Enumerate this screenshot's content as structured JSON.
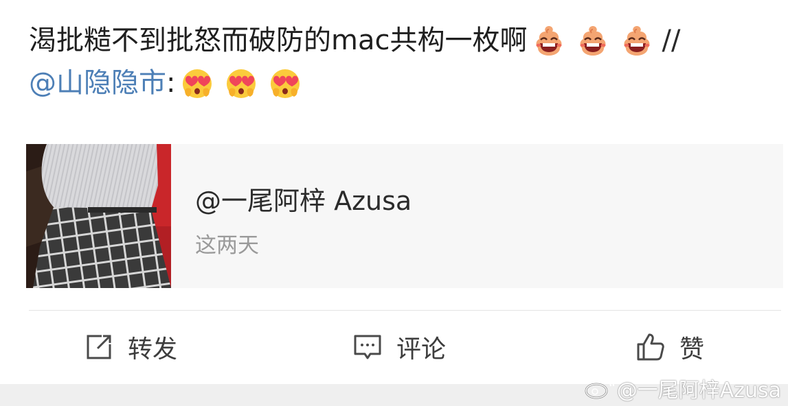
{
  "post": {
    "line1_text": "渴批糙不到批怒而破防的mac共构一枚啊",
    "line1_emojis": [
      "haha-emoji",
      "haha-emoji",
      "haha-emoji"
    ],
    "repost_separator": "//",
    "mention": "@山隐隐市",
    "colon": ":",
    "line2_emojis": [
      "heart-eyes-emoji",
      "heart-eyes-emoji",
      "heart-eyes-emoji"
    ]
  },
  "card": {
    "author": "@一尾阿梓 Azusa",
    "subtitle": "这两天"
  },
  "actions": {
    "repost": "转发",
    "comment": "评论",
    "like": "赞"
  },
  "watermark": {
    "text": "@一尾阿梓Azusa"
  },
  "colors": {
    "mention": "#4d7fb6",
    "text": "#1f1f1f",
    "card_bg": "#f7f7f7",
    "subtitle": "#9a9a9a"
  }
}
